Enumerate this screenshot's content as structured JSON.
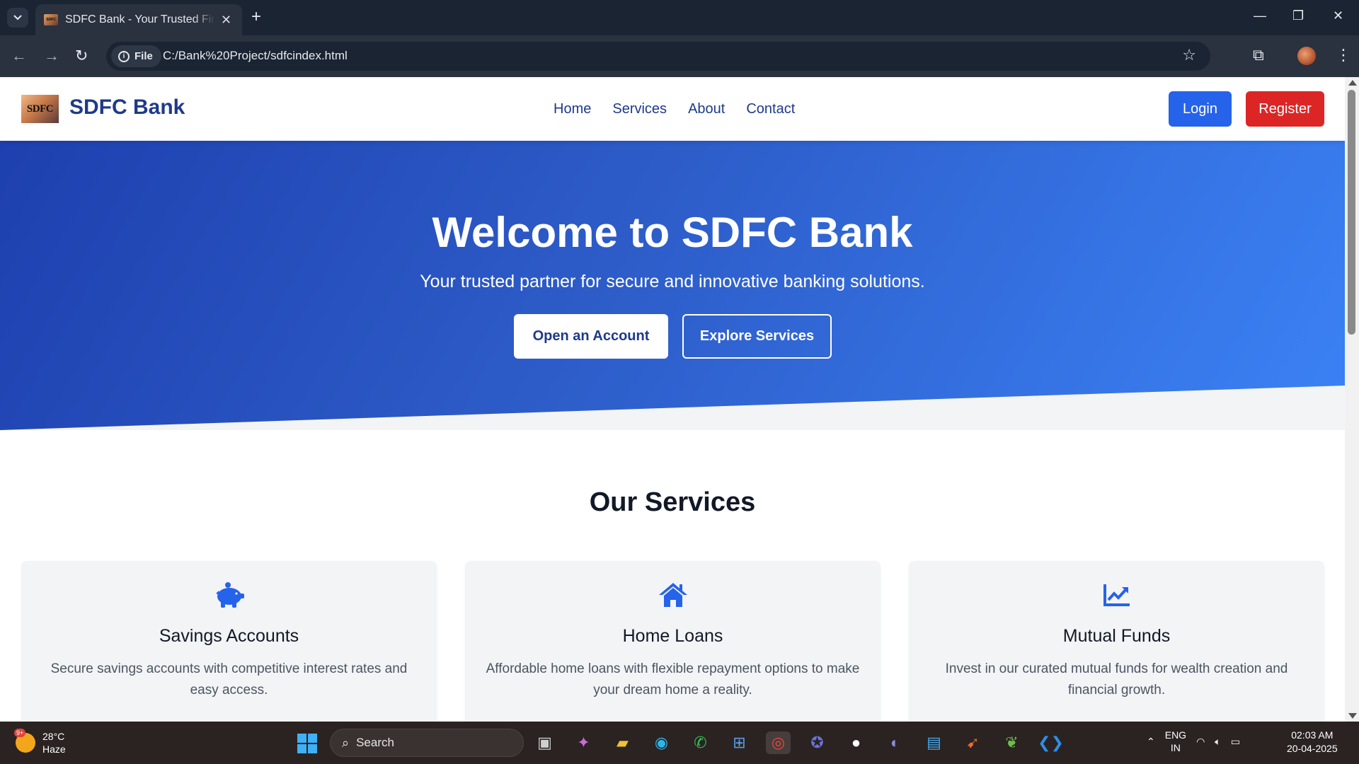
{
  "browser": {
    "tab_title": "SDFC Bank - Your Trusted Financial Partner",
    "site_chip": "File",
    "url": "C:/Bank%20Project/sdfcindex.html"
  },
  "nav": {
    "logo_text": "SDFC",
    "brand": "SDFC Bank",
    "links": [
      "Home",
      "Services",
      "About",
      "Contact"
    ],
    "login_label": "Login",
    "register_label": "Register"
  },
  "hero": {
    "title": "Welcome to SDFC Bank",
    "subtitle": "Your trusted partner for secure and innovative banking solutions.",
    "primary_cta": "Open an Account",
    "secondary_cta": "Explore Services"
  },
  "services": {
    "heading": "Our Services",
    "items": [
      {
        "icon": "piggy-bank-icon",
        "title": "Savings Accounts",
        "text": "Secure savings accounts with competitive interest rates and easy access."
      },
      {
        "icon": "home-icon",
        "title": "Home Loans",
        "text": "Affordable home loans with flexible repayment options to make your dream home a reality."
      },
      {
        "icon": "chart-line-icon",
        "title": "Mutual Funds",
        "text": "Invest in our curated mutual funds for wealth creation and financial growth."
      }
    ]
  },
  "colors": {
    "brand_blue": "#1e3a8a",
    "login_blue": "#2563eb",
    "register_red": "#dc2626",
    "icon_blue": "#2563eb"
  },
  "taskbar": {
    "weather_badge": "9+",
    "temperature": "28°C",
    "condition": "Haze",
    "search_label": "Search",
    "lang_top": "ENG",
    "lang_bottom": "IN",
    "time": "02:03 AM",
    "date": "20-04-2025"
  }
}
